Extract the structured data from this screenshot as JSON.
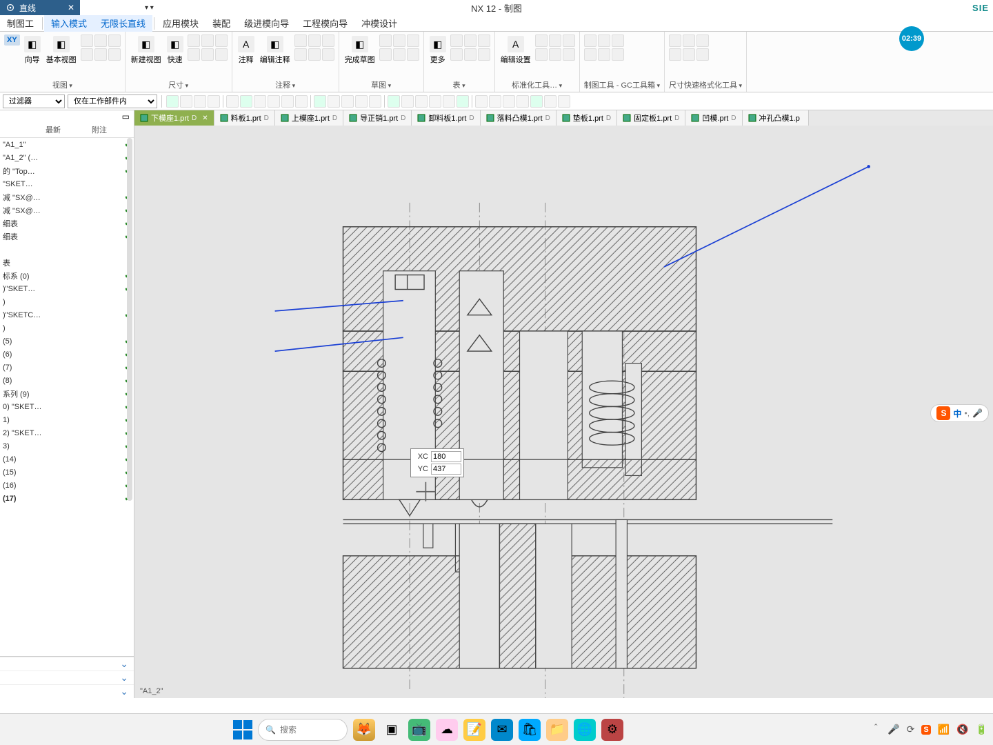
{
  "title_bar": {
    "online_label": "直线",
    "app_title": "NX 12 - 制图",
    "brand": "SIE"
  },
  "timer": "02:39",
  "menu": {
    "items": [
      "制图工",
      "输入模式",
      "无限长直线",
      "应用模块",
      "装配",
      "级进模向导",
      "工程模向导",
      "冲模设计"
    ],
    "active_indices": [
      1,
      2
    ]
  },
  "ribbon": {
    "groups": [
      {
        "label": "视图",
        "buttons": [
          "向导",
          "基本视图"
        ],
        "xy": "XY"
      },
      {
        "label": "尺寸",
        "buttons": [
          "新建视图",
          "快速"
        ]
      },
      {
        "label": "注释",
        "buttons": [
          "注释",
          "编辑注释"
        ],
        "a_icon": "A"
      },
      {
        "label": "草图",
        "buttons": [
          "完成草图"
        ]
      },
      {
        "label": "表",
        "buttons": [
          "更多"
        ]
      },
      {
        "label": "标准化工具…",
        "buttons": [
          "编辑设置"
        ],
        "a_icon": "A"
      },
      {
        "label": "制图工具 - GC工具箱"
      },
      {
        "label": "尺寸快速格式化工具"
      }
    ]
  },
  "selector_row": {
    "filter_label": "过滤器",
    "work_part_label": "仅在工作部件内"
  },
  "doc_tabs": [
    {
      "label": "下模座1.prt",
      "mod": "D",
      "active": true
    },
    {
      "label": "料板1.prt",
      "mod": "D"
    },
    {
      "label": "上模座1.prt",
      "mod": "D"
    },
    {
      "label": "导正销1.prt",
      "mod": "D"
    },
    {
      "label": "卸料板1.prt",
      "mod": "D"
    },
    {
      "label": "落料凸模1.prt",
      "mod": "D"
    },
    {
      "label": "垫板1.prt",
      "mod": "D"
    },
    {
      "label": "固定板1.prt",
      "mod": "D"
    },
    {
      "label": "凹模.prt",
      "mod": "D"
    },
    {
      "label": "冲孔凸模1.p",
      "mod": ""
    }
  ],
  "tree": {
    "header": [
      "",
      "最新",
      "附注"
    ],
    "rows": [
      {
        "name": "\"A1_1\"",
        "status": "✔"
      },
      {
        "name": "\"A1_2\" (…",
        "status": "✔"
      },
      {
        "name": "的 \"Top…",
        "status": "✔"
      },
      {
        "name": "\"SKET…",
        "status": ""
      },
      {
        "name": "减 \"SX@…",
        "status": "✔"
      },
      {
        "name": "减 \"SX@…",
        "status": "✔"
      },
      {
        "name": "细表",
        "status": "✔"
      },
      {
        "name": "细表",
        "status": "✔"
      },
      {
        "name": "",
        "status": ""
      },
      {
        "name": "表",
        "status": ""
      },
      {
        "name": "标系 (0)",
        "status": "✔"
      },
      {
        "name": ")\"SKET…",
        "status": "✔"
      },
      {
        "name": ")",
        "status": ""
      },
      {
        "name": ")\"SKETC…",
        "status": "✔"
      },
      {
        "name": ")",
        "status": ""
      },
      {
        "name": "(5)",
        "status": "✔"
      },
      {
        "name": "(6)",
        "status": "✔"
      },
      {
        "name": "(7)",
        "status": "✔"
      },
      {
        "name": "(8)",
        "status": "✔"
      },
      {
        "name": "系列 (9)",
        "status": "✔"
      },
      {
        "name": "0) \"SKET…",
        "status": "✔"
      },
      {
        "name": "1)",
        "status": "✔"
      },
      {
        "name": "2) \"SKET…",
        "status": "✔"
      },
      {
        "name": "3)",
        "status": "✔"
      },
      {
        "name": "(14)",
        "status": "✔"
      },
      {
        "name": "(15)",
        "status": "✔"
      },
      {
        "name": "(16)",
        "status": "✔"
      },
      {
        "name": "(17)",
        "status": "✔",
        "bold": true
      }
    ]
  },
  "coord": {
    "xc_label": "XC",
    "xc_value": "180",
    "yc_label": "YC",
    "yc_value": "437"
  },
  "canvas_status": "\"A1_2\"",
  "ime": {
    "logo": "S",
    "mode": "中"
  },
  "taskbar": {
    "search_placeholder": "搜索"
  }
}
